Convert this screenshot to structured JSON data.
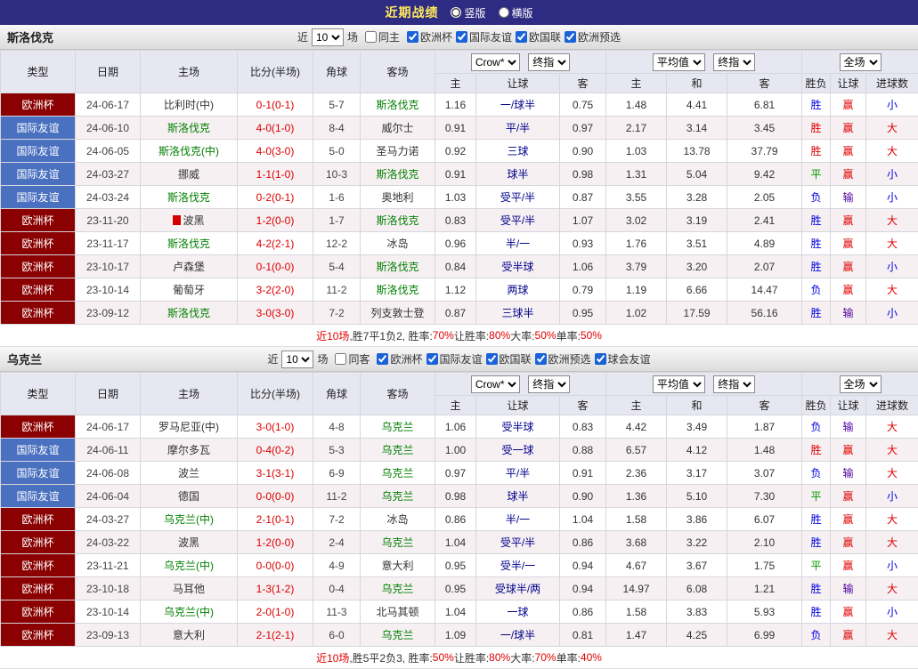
{
  "topbar": {
    "title": "近期战绩",
    "radios": [
      {
        "label": "竖版",
        "selected": true
      },
      {
        "label": "横版",
        "selected": false
      }
    ]
  },
  "colors": {
    "topbar_bg": "#2e2b82",
    "title_text": "#ffe95e",
    "euro_type_bg": "#8b0000",
    "friendly_type_bg": "#4a70c0",
    "focal_team": "#008000",
    "score_red": "#dd0000",
    "win_blue": "#0000e0",
    "win_red": "#e00000",
    "draw_green": "#009900",
    "lose_purple": "#5000a0",
    "header_bg": "#e7e7f2"
  },
  "table_header": {
    "static_cols": [
      "类型",
      "日期",
      "主场",
      "比分(半场)",
      "角球",
      "客场"
    ],
    "groups": [
      {
        "selects": [
          "Crow*",
          "终指"
        ]
      },
      {
        "selects": [
          "平均值",
          "终指"
        ]
      },
      {
        "selects": [
          "全场"
        ]
      }
    ],
    "sub": [
      "主",
      "让球",
      "客",
      "主",
      "和",
      "客",
      "胜负",
      "让球",
      "进球数"
    ]
  },
  "sections": [
    {
      "team": "斯洛伐克",
      "filters": {
        "prefix": "近",
        "count": "10",
        "suffix": "场",
        "same_label": "同主",
        "same_checked": false,
        "comps": [
          {
            "label": "欧洲杯",
            "checked": true
          },
          {
            "label": "国际友谊",
            "checked": true
          },
          {
            "label": "欧国联",
            "checked": true
          },
          {
            "label": "欧洲预选",
            "checked": true
          }
        ]
      },
      "rows": [
        {
          "type": "欧洲杯",
          "tc": "euro",
          "date": "24-06-17",
          "home": "比利时(中)",
          "hf": false,
          "hi": false,
          "score": "0-1(0-1)",
          "corner": "5-7",
          "away": "斯洛伐克",
          "af": true,
          "o": [
            "1.16",
            "一/球半",
            "0.75",
            "1.48",
            "4.41",
            "6.81"
          ],
          "r": [
            [
              "胜",
              "blue"
            ],
            [
              "赢",
              "red"
            ],
            [
              "小",
              "blue"
            ]
          ]
        },
        {
          "type": "国际友谊",
          "tc": "friendly",
          "date": "24-06-10",
          "home": "斯洛伐克",
          "hf": true,
          "hi": false,
          "score": "4-0(1-0)",
          "corner": "8-4",
          "away": "威尔士",
          "af": false,
          "o": [
            "0.91",
            "平/半",
            "0.97",
            "2.17",
            "3.14",
            "3.45"
          ],
          "r": [
            [
              "胜",
              "red"
            ],
            [
              "赢",
              "red"
            ],
            [
              "大",
              "red"
            ]
          ]
        },
        {
          "type": "国际友谊",
          "tc": "friendly",
          "date": "24-06-05",
          "home": "斯洛伐克(中)",
          "hf": true,
          "hi": false,
          "score": "4-0(3-0)",
          "corner": "5-0",
          "away": "圣马力诺",
          "af": false,
          "o": [
            "0.92",
            "三球",
            "0.90",
            "1.03",
            "13.78",
            "37.79"
          ],
          "r": [
            [
              "胜",
              "red"
            ],
            [
              "赢",
              "red"
            ],
            [
              "大",
              "red"
            ]
          ]
        },
        {
          "type": "国际友谊",
          "tc": "friendly",
          "date": "24-03-27",
          "home": "挪威",
          "hf": false,
          "hi": false,
          "score": "1-1(1-0)",
          "corner": "10-3",
          "away": "斯洛伐克",
          "af": true,
          "o": [
            "0.91",
            "球半",
            "0.98",
            "1.31",
            "5.04",
            "9.42"
          ],
          "r": [
            [
              "平",
              "green"
            ],
            [
              "赢",
              "red"
            ],
            [
              "小",
              "blue"
            ]
          ]
        },
        {
          "type": "国际友谊",
          "tc": "friendly",
          "date": "24-03-24",
          "home": "斯洛伐克",
          "hf": true,
          "hi": false,
          "score": "0-2(0-1)",
          "corner": "1-6",
          "away": "奥地利",
          "af": false,
          "o": [
            "1.03",
            "受平/半",
            "0.87",
            "3.55",
            "3.28",
            "2.05"
          ],
          "r": [
            [
              "负",
              "blue"
            ],
            [
              "输",
              "purple"
            ],
            [
              "小",
              "blue"
            ]
          ]
        },
        {
          "type": "欧洲杯",
          "tc": "euro",
          "date": "23-11-20",
          "home": "波黑",
          "hf": false,
          "hi": true,
          "score": "1-2(0-0)",
          "corner": "1-7",
          "away": "斯洛伐克",
          "af": true,
          "o": [
            "0.83",
            "受平/半",
            "1.07",
            "3.02",
            "3.19",
            "2.41"
          ],
          "r": [
            [
              "胜",
              "blue"
            ],
            [
              "赢",
              "red"
            ],
            [
              "大",
              "red"
            ]
          ]
        },
        {
          "type": "欧洲杯",
          "tc": "euro",
          "date": "23-11-17",
          "home": "斯洛伐克",
          "hf": true,
          "hi": false,
          "score": "4-2(2-1)",
          "corner": "12-2",
          "away": "冰岛",
          "af": false,
          "o": [
            "0.96",
            "半/一",
            "0.93",
            "1.76",
            "3.51",
            "4.89"
          ],
          "r": [
            [
              "胜",
              "blue"
            ],
            [
              "赢",
              "red"
            ],
            [
              "大",
              "red"
            ]
          ]
        },
        {
          "type": "欧洲杯",
          "tc": "euro",
          "date": "23-10-17",
          "home": "卢森堡",
          "hf": false,
          "hi": false,
          "score": "0-1(0-0)",
          "corner": "5-4",
          "away": "斯洛伐克",
          "af": true,
          "o": [
            "0.84",
            "受半球",
            "1.06",
            "3.79",
            "3.20",
            "2.07"
          ],
          "r": [
            [
              "胜",
              "blue"
            ],
            [
              "赢",
              "red"
            ],
            [
              "小",
              "blue"
            ]
          ]
        },
        {
          "type": "欧洲杯",
          "tc": "euro",
          "date": "23-10-14",
          "home": "葡萄牙",
          "hf": false,
          "hi": false,
          "score": "3-2(2-0)",
          "corner": "11-2",
          "away": "斯洛伐克",
          "af": true,
          "o": [
            "1.12",
            "两球",
            "0.79",
            "1.19",
            "6.66",
            "14.47"
          ],
          "r": [
            [
              "负",
              "blue"
            ],
            [
              "赢",
              "red"
            ],
            [
              "大",
              "red"
            ]
          ]
        },
        {
          "type": "欧洲杯",
          "tc": "euro",
          "date": "23-09-12",
          "home": "斯洛伐克",
          "hf": true,
          "hi": false,
          "score": "3-0(3-0)",
          "corner": "7-2",
          "away": "列支敦士登",
          "af": false,
          "o": [
            "0.87",
            "三球半",
            "0.95",
            "1.02",
            "17.59",
            "56.16"
          ],
          "r": [
            [
              "胜",
              "blue"
            ],
            [
              "输",
              "purple"
            ],
            [
              "小",
              "blue"
            ]
          ]
        }
      ],
      "summary": [
        {
          "t": "近10场",
          "c": "red"
        },
        {
          "t": ",胜7平1负2, 胜率:",
          "c": "dark"
        },
        {
          "t": "70%",
          "c": "red"
        },
        {
          "t": " 让胜率:",
          "c": "dark"
        },
        {
          "t": "80%",
          "c": "red"
        },
        {
          "t": " 大率:",
          "c": "dark"
        },
        {
          "t": "50%",
          "c": "red"
        },
        {
          "t": " 单率:",
          "c": "dark"
        },
        {
          "t": "50%",
          "c": "red"
        }
      ]
    },
    {
      "team": "乌克兰",
      "filters": {
        "prefix": "近",
        "count": "10",
        "suffix": "场",
        "same_label": "同客",
        "same_checked": false,
        "comps": [
          {
            "label": "欧洲杯",
            "checked": true
          },
          {
            "label": "国际友谊",
            "checked": true
          },
          {
            "label": "欧国联",
            "checked": true
          },
          {
            "label": "欧洲预选",
            "checked": true
          },
          {
            "label": "球会友谊",
            "checked": true
          }
        ]
      },
      "rows": [
        {
          "type": "欧洲杯",
          "tc": "euro",
          "date": "24-06-17",
          "home": "罗马尼亚(中)",
          "hf": false,
          "hi": false,
          "score": "3-0(1-0)",
          "corner": "4-8",
          "away": "乌克兰",
          "af": true,
          "o": [
            "1.06",
            "受半球",
            "0.83",
            "4.42",
            "3.49",
            "1.87"
          ],
          "r": [
            [
              "负",
              "blue"
            ],
            [
              "输",
              "purple"
            ],
            [
              "大",
              "red"
            ]
          ]
        },
        {
          "type": "国际友谊",
          "tc": "friendly",
          "date": "24-06-11",
          "home": "摩尔多瓦",
          "hf": false,
          "hi": false,
          "score": "0-4(0-2)",
          "corner": "5-3",
          "away": "乌克兰",
          "af": true,
          "o": [
            "1.00",
            "受一球",
            "0.88",
            "6.57",
            "4.12",
            "1.48"
          ],
          "r": [
            [
              "胜",
              "red"
            ],
            [
              "赢",
              "red"
            ],
            [
              "大",
              "red"
            ]
          ]
        },
        {
          "type": "国际友谊",
          "tc": "friendly",
          "date": "24-06-08",
          "home": "波兰",
          "hf": false,
          "hi": false,
          "score": "3-1(3-1)",
          "corner": "6-9",
          "away": "乌克兰",
          "af": true,
          "o": [
            "0.97",
            "平/半",
            "0.91",
            "2.36",
            "3.17",
            "3.07"
          ],
          "r": [
            [
              "负",
              "blue"
            ],
            [
              "输",
              "purple"
            ],
            [
              "大",
              "red"
            ]
          ]
        },
        {
          "type": "国际友谊",
          "tc": "friendly",
          "date": "24-06-04",
          "home": "德国",
          "hf": false,
          "hi": false,
          "score": "0-0(0-0)",
          "corner": "11-2",
          "away": "乌克兰",
          "af": true,
          "o": [
            "0.98",
            "球半",
            "0.90",
            "1.36",
            "5.10",
            "7.30"
          ],
          "r": [
            [
              "平",
              "green"
            ],
            [
              "赢",
              "red"
            ],
            [
              "小",
              "blue"
            ]
          ]
        },
        {
          "type": "欧洲杯",
          "tc": "euro",
          "date": "24-03-27",
          "home": "乌克兰(中)",
          "hf": true,
          "hi": false,
          "score": "2-1(0-1)",
          "corner": "7-2",
          "away": "冰岛",
          "af": false,
          "o": [
            "0.86",
            "半/一",
            "1.04",
            "1.58",
            "3.86",
            "6.07"
          ],
          "r": [
            [
              "胜",
              "blue"
            ],
            [
              "赢",
              "red"
            ],
            [
              "大",
              "red"
            ]
          ]
        },
        {
          "type": "欧洲杯",
          "tc": "euro",
          "date": "24-03-22",
          "home": "波黑",
          "hf": false,
          "hi": false,
          "score": "1-2(0-0)",
          "corner": "2-4",
          "away": "乌克兰",
          "af": true,
          "o": [
            "1.04",
            "受平/半",
            "0.86",
            "3.68",
            "3.22",
            "2.10"
          ],
          "r": [
            [
              "胜",
              "blue"
            ],
            [
              "赢",
              "red"
            ],
            [
              "大",
              "red"
            ]
          ]
        },
        {
          "type": "欧洲杯",
          "tc": "euro",
          "date": "23-11-21",
          "home": "乌克兰(中)",
          "hf": true,
          "hi": false,
          "score": "0-0(0-0)",
          "corner": "4-9",
          "away": "意大利",
          "af": false,
          "o": [
            "0.95",
            "受半/一",
            "0.94",
            "4.67",
            "3.67",
            "1.75"
          ],
          "r": [
            [
              "平",
              "green"
            ],
            [
              "赢",
              "red"
            ],
            [
              "小",
              "blue"
            ]
          ]
        },
        {
          "type": "欧洲杯",
          "tc": "euro",
          "date": "23-10-18",
          "home": "马耳他",
          "hf": false,
          "hi": false,
          "score": "1-3(1-2)",
          "corner": "0-4",
          "away": "乌克兰",
          "af": true,
          "o": [
            "0.95",
            "受球半/两",
            "0.94",
            "14.97",
            "6.08",
            "1.21"
          ],
          "r": [
            [
              "胜",
              "blue"
            ],
            [
              "输",
              "purple"
            ],
            [
              "大",
              "red"
            ]
          ]
        },
        {
          "type": "欧洲杯",
          "tc": "euro",
          "date": "23-10-14",
          "home": "乌克兰(中)",
          "hf": true,
          "hi": false,
          "score": "2-0(1-0)",
          "corner": "11-3",
          "away": "北马其顿",
          "af": false,
          "o": [
            "1.04",
            "一球",
            "0.86",
            "1.58",
            "3.83",
            "5.93"
          ],
          "r": [
            [
              "胜",
              "blue"
            ],
            [
              "赢",
              "red"
            ],
            [
              "小",
              "blue"
            ]
          ]
        },
        {
          "type": "欧洲杯",
          "tc": "euro",
          "date": "23-09-13",
          "home": "意大利",
          "hf": false,
          "hi": false,
          "score": "2-1(2-1)",
          "corner": "6-0",
          "away": "乌克兰",
          "af": true,
          "o": [
            "1.09",
            "一/球半",
            "0.81",
            "1.47",
            "4.25",
            "6.99"
          ],
          "r": [
            [
              "负",
              "blue"
            ],
            [
              "赢",
              "red"
            ],
            [
              "大",
              "red"
            ]
          ]
        }
      ],
      "summary": [
        {
          "t": "近10场",
          "c": "red"
        },
        {
          "t": ",胜5平2负3, 胜率:",
          "c": "dark"
        },
        {
          "t": "50%",
          "c": "red"
        },
        {
          "t": " 让胜率:",
          "c": "dark"
        },
        {
          "t": "80%",
          "c": "red"
        },
        {
          "t": " 大率:",
          "c": "dark"
        },
        {
          "t": "70%",
          "c": "red"
        },
        {
          "t": " 单率:",
          "c": "dark"
        },
        {
          "t": "40%",
          "c": "red"
        }
      ]
    }
  ]
}
